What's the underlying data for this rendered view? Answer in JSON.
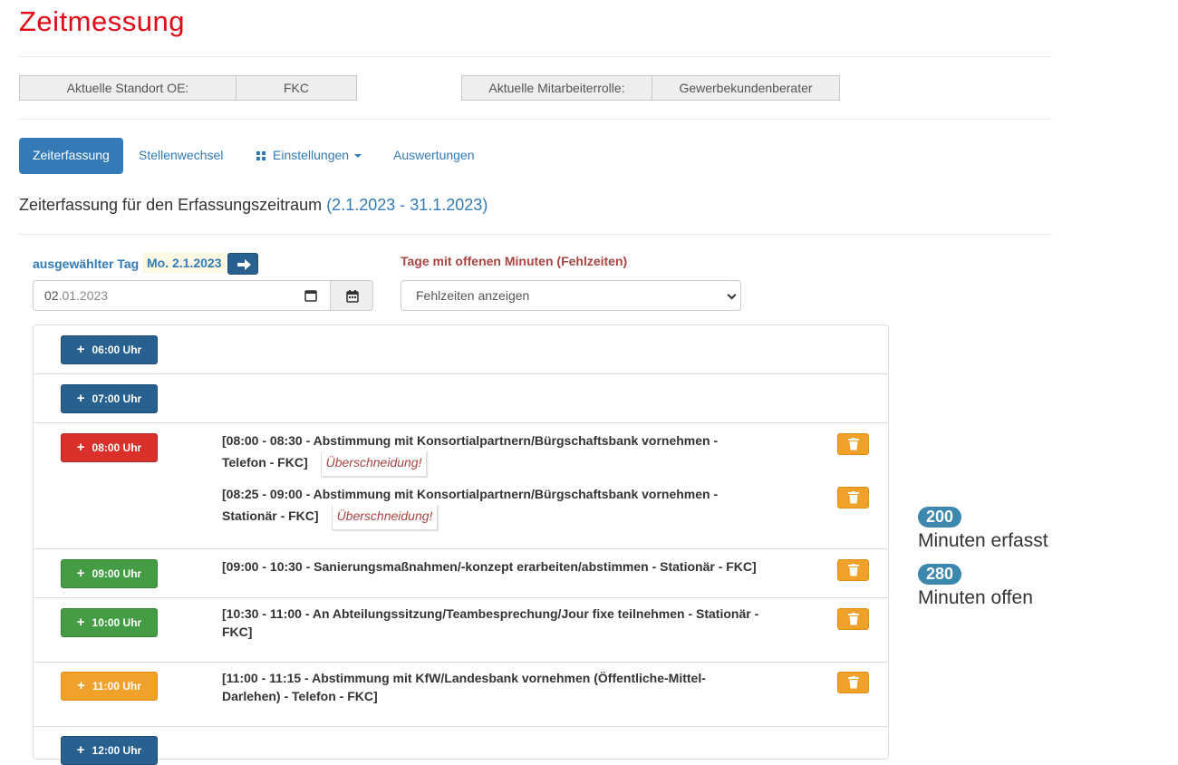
{
  "page": {
    "title": "Zeitmessung"
  },
  "info": {
    "standort_label": "Aktuelle Standort OE:",
    "standort_value": "FKC",
    "rolle_label": "Aktuelle Mitarbeiterrolle:",
    "rolle_value": "Gewerbekundenberater"
  },
  "tabs": [
    {
      "label": "Zeiterfassung",
      "active": true
    },
    {
      "label": "Stellenwechsel"
    },
    {
      "label": "Einstellungen",
      "icon": "grid-icon",
      "dropdown": true
    },
    {
      "label": "Auswertungen"
    }
  ],
  "period": {
    "text": "Zeiterfassung für den Erfassungszeitraum",
    "range": "(2.1.2023 - 31.1.2023)"
  },
  "day": {
    "label": "ausgewählter Tag",
    "value": "Mo. 2.1.2023",
    "date_day": "02",
    "date_rest": ".01.2023"
  },
  "missing": {
    "label": "Tage mit offenen Minuten (Fehlzeiten)",
    "select_value": "Fehlzeiten anzeigen"
  },
  "colors": {
    "blue": "#286090",
    "red": "#d9302b",
    "green": "#449d44",
    "orange": "#f0a12a",
    "title_red": "#e30613"
  },
  "slots": [
    {
      "time": "06:00 Uhr",
      "status": "blue",
      "entries": []
    },
    {
      "time": "07:00 Uhr",
      "status": "blue",
      "entries": []
    },
    {
      "time": "08:00 Uhr",
      "status": "red",
      "entries": [
        {
          "line1": "[08:00 - 08:30 - Abstimmung mit Konsortialpartnern/Bürgschaftsbank vornehmen -",
          "line2": "Telefon - FKC]",
          "warning": "Überschneidung!"
        },
        {
          "line1": "[08:25 - 09:00 - Abstimmung mit Konsortialpartnern/Bürgschaftsbank vornehmen -",
          "line2": "Stationär - FKC]",
          "warning": "Überschneidung!"
        }
      ]
    },
    {
      "time": "09:00 Uhr",
      "status": "green",
      "entries": [
        {
          "line1": "[09:00 - 10:30 - Sanierungsmaßnahmen/-konzept erarbeiten/abstimmen - Stationär - FKC]"
        }
      ]
    },
    {
      "time": "10:00 Uhr",
      "status": "green",
      "entries": [
        {
          "line1": "[10:30 - 11:00 - An Abteilungssitzung/Teambesprechung/Jour fixe teilnehmen - Stationär -",
          "line2": "FKC]"
        }
      ]
    },
    {
      "time": "11:00 Uhr",
      "status": "orange",
      "entries": [
        {
          "line1": "[11:00 - 11:15 - Abstimmung mit KfW/Landesbank vornehmen (Öffentliche-Mittel-",
          "line2": "Darlehen) - Telefon - FKC]"
        }
      ]
    },
    {
      "time": "12:00 Uhr",
      "status": "blue",
      "entries": []
    }
  ],
  "stats": {
    "erfasst_value": "200",
    "erfasst_label": "Minuten erfasst",
    "offen_value": "280",
    "offen_label": "Minuten offen"
  }
}
